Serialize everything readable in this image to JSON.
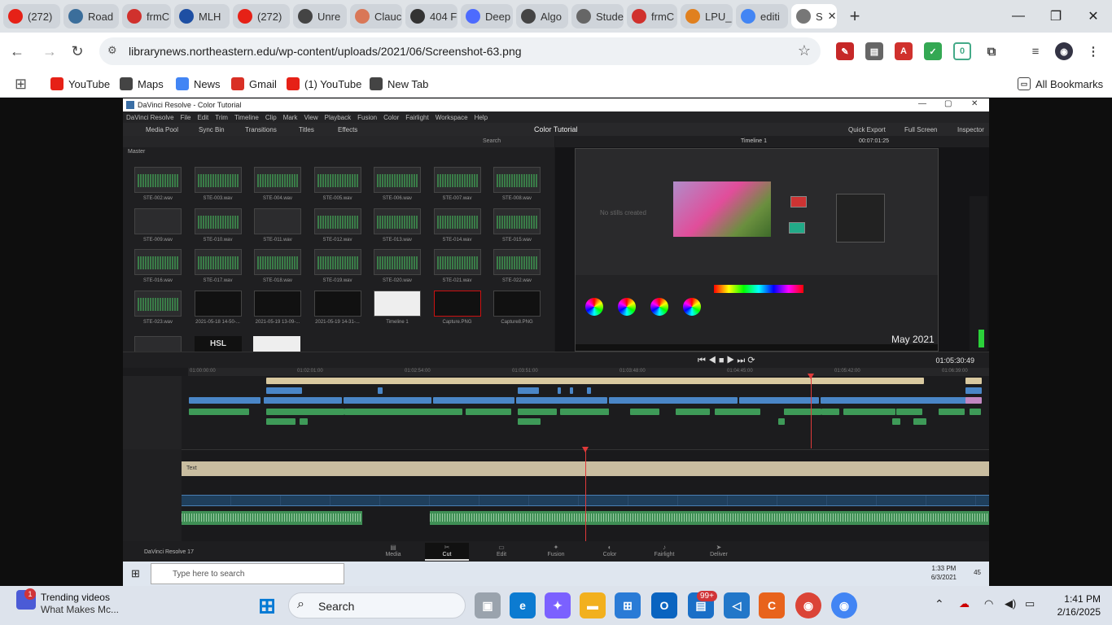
{
  "browser": {
    "tabs": [
      {
        "label": "(272)",
        "color": "#e62117"
      },
      {
        "label": "Road",
        "color": "#3b6e9b"
      },
      {
        "label": "frmC",
        "color": "#d0312d"
      },
      {
        "label": "MLH",
        "color": "#1e4fa3"
      },
      {
        "label": "(272)",
        "color": "#e62117"
      },
      {
        "label": "Unre",
        "color": "#444"
      },
      {
        "label": "Clauc",
        "color": "#d97757"
      },
      {
        "label": "404 F",
        "color": "#333"
      },
      {
        "label": "Deep",
        "color": "#4d6bfe"
      },
      {
        "label": "Algo",
        "color": "#444"
      },
      {
        "label": "Stude",
        "color": "#666"
      },
      {
        "label": "frmC",
        "color": "#d0312d"
      },
      {
        "label": "LPU_",
        "color": "#e0801f"
      },
      {
        "label": "editi",
        "color": "#4285f4"
      },
      {
        "label": "S",
        "color": "#777"
      }
    ],
    "new_tab": "+",
    "url": "librarynews.northeastern.edu/wp-content/uploads/2021/06/Screenshot-63.png",
    "bookmarks": [
      {
        "label": "YouTube",
        "color": "#e62117"
      },
      {
        "label": "Maps",
        "color": "#444"
      },
      {
        "label": "News",
        "color": "#4285f4"
      },
      {
        "label": "Gmail",
        "color": "#d93025"
      },
      {
        "label": "(1) YouTube",
        "color": "#e62117"
      },
      {
        "label": "New Tab",
        "color": "#444"
      }
    ],
    "all_bookmarks": "All Bookmarks"
  },
  "resolve": {
    "window_title": "DaVinci Resolve - Color Tutorial",
    "menu": [
      "DaVinci Resolve",
      "File",
      "Edit",
      "Trim",
      "Timeline",
      "Clip",
      "Mark",
      "View",
      "Playback",
      "Fusion",
      "Color",
      "Fairlight",
      "Workspace",
      "Help"
    ],
    "toolbar": {
      "media_pool": "Media Pool",
      "sync_bin": "Sync Bin",
      "transitions": "Transitions",
      "titles": "Titles",
      "effects": "Effects",
      "project_title": "Color Tutorial",
      "quick_export": "Quick Export",
      "full_screen": "Full Screen",
      "inspector": "Inspector"
    },
    "pool": {
      "search": "Search",
      "master": "Master",
      "clips": [
        {
          "name": "STE-002.wav",
          "kind": "wave"
        },
        {
          "name": "STE-003.wav",
          "kind": "wave"
        },
        {
          "name": "STE-004.wav",
          "kind": "wave"
        },
        {
          "name": "STE-005.wav",
          "kind": "wave"
        },
        {
          "name": "STE-006.wav",
          "kind": "wave"
        },
        {
          "name": "STE-007.wav",
          "kind": "wave"
        },
        {
          "name": "STE-008.wav",
          "kind": "wave"
        },
        {
          "name": "STE-009.wav",
          "kind": "empty"
        },
        {
          "name": "STE-010.wav",
          "kind": "wave"
        },
        {
          "name": "STE-011.wav",
          "kind": "empty"
        },
        {
          "name": "STE-012.wav",
          "kind": "wave"
        },
        {
          "name": "STE-013.wav",
          "kind": "wave"
        },
        {
          "name": "STE-014.wav",
          "kind": "wave"
        },
        {
          "name": "STE-015.wav",
          "kind": "wave"
        },
        {
          "name": "STE-016.wav",
          "kind": "wave"
        },
        {
          "name": "STE-017.wav",
          "kind": "wave"
        },
        {
          "name": "STE-018.wav",
          "kind": "wave"
        },
        {
          "name": "STE-019.wav",
          "kind": "wave"
        },
        {
          "name": "STE-020.wav",
          "kind": "wave"
        },
        {
          "name": "STE-021.wav",
          "kind": "wave"
        },
        {
          "name": "STE-022.wav",
          "kind": "wave"
        },
        {
          "name": "STE-023.wav",
          "kind": "wave"
        },
        {
          "name": "2021-05-18 14-50-...",
          "kind": "img"
        },
        {
          "name": "2021-05-19 13-09-...",
          "kind": "img"
        },
        {
          "name": "2021-05-19 14-31-...",
          "kind": "img"
        },
        {
          "name": "Timeline 1",
          "kind": "white"
        },
        {
          "name": "Capture.PNG",
          "kind": "red"
        },
        {
          "name": "Capture8.PNG",
          "kind": "img"
        }
      ],
      "hsl_label": "HSL"
    },
    "viewer": {
      "timeline_name": "Timeline 1",
      "source_tc": "00:07:01:25",
      "no_stills": "No stills created",
      "date_overlay": "May 2021"
    },
    "transport": {
      "timecode": "01:05:30:49"
    },
    "ruler_upper": [
      "01:00:00:00",
      "01:02:01:00",
      "01:02:54:00",
      "01:03:51:00",
      "01:03:48:00",
      "01:04:45:00",
      "01:05:42:00",
      "01:06:39:00"
    ],
    "text_clip": "Text",
    "pages": [
      "Media",
      "Cut",
      "Edit",
      "Fusion",
      "Color",
      "Fairlight",
      "Deliver"
    ],
    "active_page": "Cut",
    "brand": "DaVinci Resolve 17",
    "win_taskbar": {
      "search": "Type here to search",
      "time": "1:33 PM",
      "date": "6/3/2021",
      "notif": "45"
    }
  },
  "taskbar": {
    "trending_title": "Trending videos",
    "trending_sub": "What Makes Mc...",
    "trending_badge": "1",
    "search": "Search",
    "badge_count": "99+",
    "time": "1:41 PM",
    "date": "2/16/2025"
  }
}
